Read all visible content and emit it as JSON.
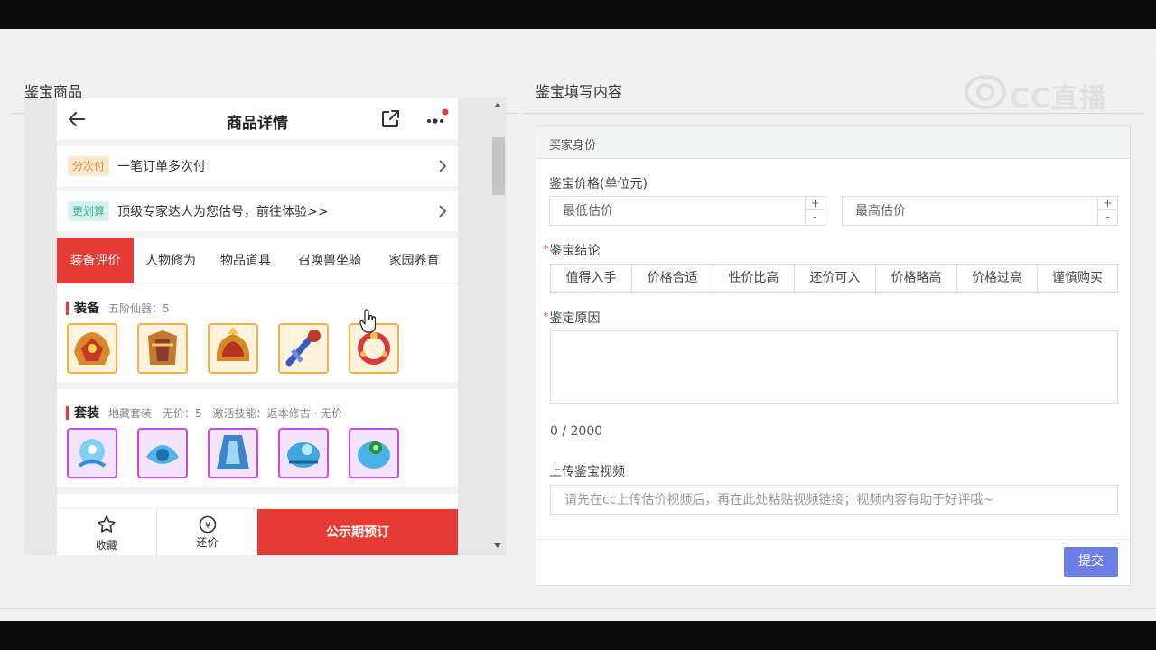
{
  "left_section": {
    "title": "鉴宝商品"
  },
  "right_section": {
    "title": "鉴宝填写内容"
  },
  "logo": {
    "text": "CC直播"
  },
  "phone": {
    "header": {
      "title": "商品详情"
    },
    "rows": [
      {
        "tag": "分次付",
        "text": "一笔订单多次付"
      },
      {
        "tag": "更划算",
        "text": "顶级专家达人为您估号，前往体验>>"
      }
    ],
    "tabs": [
      "装备评价",
      "人物修为",
      "物品道具",
      "召唤兽坐骑",
      "家园养育"
    ],
    "equipment": {
      "title": "装备",
      "subtitle": "五阶仙器：5"
    },
    "suit": {
      "title": "套装",
      "subtitle": "地藏套装　无价：5　激活技能：返本修古 · 无价"
    },
    "footer": {
      "favorite": "收藏",
      "bargain": "还价",
      "bargain_icon": "¥",
      "buy": "公示期预订"
    }
  },
  "form": {
    "header": "买家身份",
    "price_label": "鉴宝价格(单位元)",
    "min_placeholder": "最低估价",
    "max_placeholder": "最高估价",
    "conclusion_label": "鉴宝结论",
    "conclusion_options": [
      "值得入手",
      "价格合适",
      "性价比高",
      "还价可入",
      "价格略高",
      "价格过高",
      "谨慎购买"
    ],
    "reason_label": "鉴定原因",
    "counter": "0 / 2000",
    "video_label": "上传鉴宝视频",
    "video_placeholder": "请先在cc上传估价视频后，再在此处粘贴视频链接；视频内容有助于好评哦~",
    "submit": "提交",
    "plus": "+",
    "minus": "-"
  },
  "colors": {
    "accent_red": "#e83a35",
    "submit_blue": "#6b7fe6",
    "gold_border": "#f0b04a",
    "purple_border": "#c84ce0"
  }
}
